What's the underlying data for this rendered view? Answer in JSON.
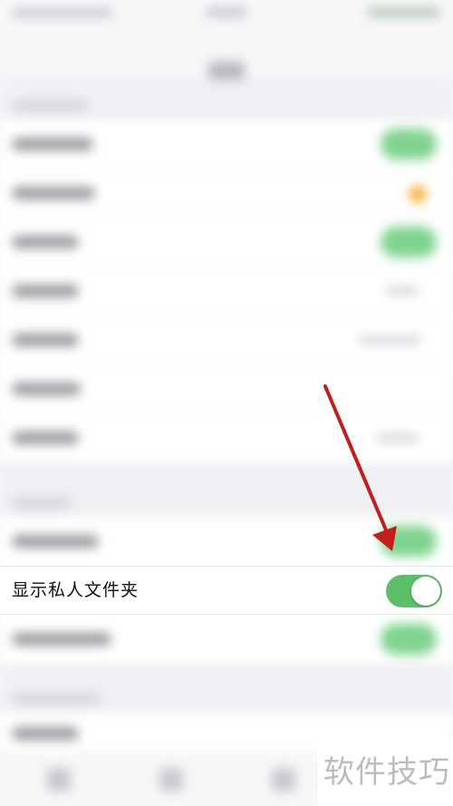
{
  "highlighted_row": {
    "label": "显示私人文件夹",
    "toggle_state": "on"
  },
  "watermark": {
    "text": "软件技巧"
  },
  "colors": {
    "toggle_on": "#5cbf68",
    "arrow": "#c0201c",
    "background": "#f7f7f9"
  },
  "icons": {
    "annotation": "red-arrow"
  }
}
